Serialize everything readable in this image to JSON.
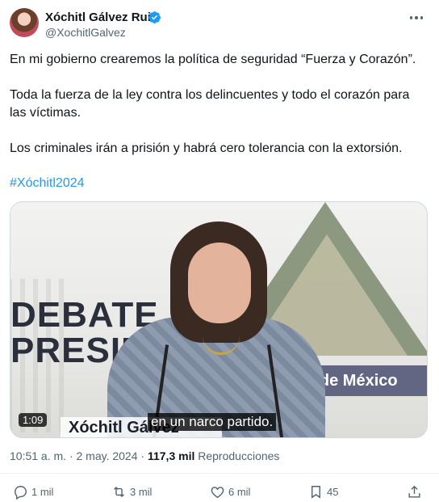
{
  "author": {
    "name": "Xóchitl Gálvez Ruiz",
    "handle": "@XochitlGalvez"
  },
  "tweet": {
    "paragraphs": [
      "En mi gobierno crearemos la política de seguridad “Fuerza y Corazón”.",
      "Toda la fuerza de la ley contra los delincuentes y todo el corazón para las víctimas.",
      "Los criminales irán a prisión y habrá cero tolerancia con la extorsión."
    ],
    "hashtag": "#Xóchitl2024"
  },
  "video": {
    "duration": "1:09",
    "subtitle": "en un narco partido.",
    "set_text_debate": "DEBATE",
    "set_text_presid": "PRESIDE",
    "set_text_mexico": "llo de México",
    "nameplate": "Xóchitl Gálvez"
  },
  "meta": {
    "time": "10:51 a. m.",
    "separator": "·",
    "date": "2 may. 2024",
    "views_count": "117,3 mil",
    "views_label": "Reproducciones"
  },
  "actions": {
    "replies": "1 mil",
    "reposts": "3 mil",
    "likes": "6 mil",
    "bookmarks": "45"
  },
  "colors": {
    "link": "#1d9bf0",
    "secondary_text": "#536471",
    "primary_text": "#0f1419"
  }
}
